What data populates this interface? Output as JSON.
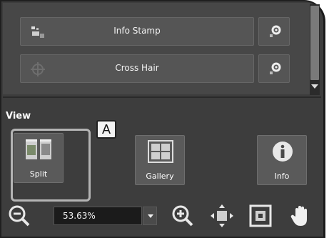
{
  "tools": {
    "items": [
      {
        "label": "Info Stamp",
        "icon": "info-stamp-icon",
        "settings_icon": "gear-icon"
      },
      {
        "label": "Cross Hair",
        "icon": "crosshair-icon",
        "settings_icon": "gear-icon"
      }
    ]
  },
  "view": {
    "heading": "View",
    "buttons": [
      {
        "label": "Split",
        "icon": "split-view-icon"
      },
      {
        "label": "Gallery",
        "icon": "gallery-icon"
      },
      {
        "label": "Info",
        "icon": "info-icon"
      }
    ]
  },
  "callout": {
    "label": "A"
  },
  "zoom": {
    "value": "53.63%",
    "tools": [
      "zoom-out-icon",
      "zoom-in-icon",
      "fit-to-window-icon",
      "actual-size-icon",
      "pan-hand-icon"
    ]
  },
  "colors": {
    "panel": "#3d3d3d",
    "button": "#5a5a5a",
    "text": "#ffffff",
    "callout_border": "#b4b4b4"
  }
}
